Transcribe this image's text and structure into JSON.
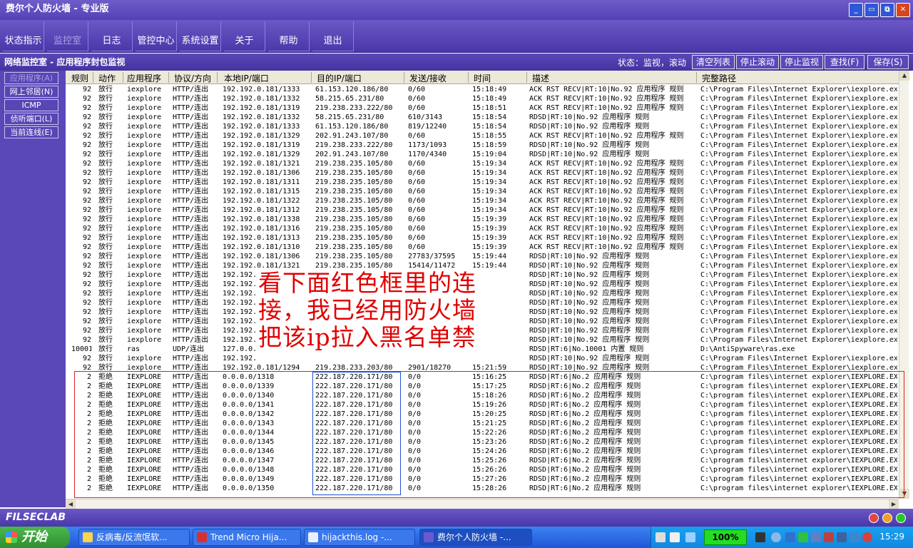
{
  "window": {
    "title": "费尔个人防火墙 - 专业版",
    "controls": [
      "_",
      "▭",
      "⧉",
      "✕"
    ]
  },
  "toolbar": [
    {
      "label": "状态指示",
      "enabled": true
    },
    {
      "label": "监控室",
      "enabled": false
    },
    {
      "label": "日志",
      "enabled": true
    },
    {
      "label": "管控中心",
      "enabled": true
    },
    {
      "label": "系统设置",
      "enabled": true
    },
    {
      "label": "关于",
      "enabled": true
    },
    {
      "label": "帮助",
      "enabled": true
    },
    {
      "label": "退出",
      "enabled": true
    }
  ],
  "subbar": {
    "title": "网络监控室 - 应用程序封包监视",
    "status": "状态：监视，滚动",
    "actions": [
      "清空列表",
      "停止滚动",
      "停止监视",
      "查找(F)",
      "保存(S)"
    ]
  },
  "sidebar": [
    {
      "label": "应用程序(A)",
      "enabled": false
    },
    {
      "label": "网上邻居(N)",
      "enabled": true
    },
    {
      "label": "ICMP",
      "enabled": true
    },
    {
      "label": "侦听端口(L)",
      "enabled": true
    },
    {
      "label": "当前连线(E)",
      "enabled": true
    }
  ],
  "columns": [
    "规则",
    "动作",
    "应用程序",
    "协议/方向",
    "本地IP/端口",
    "目的IP/端口",
    "发送/接收",
    "时间",
    "描述",
    "完整路径"
  ],
  "rows": [
    [
      "92",
      "放行",
      "iexplore",
      "HTTP/连出",
      "192.192.0.181/1333",
      "61.153.120.186/80",
      "0/60",
      "15:18:49",
      "ACK RST RECV|RT:10|No.92 应用程序 规则",
      "C:\\Program Files\\Internet Explorer\\iexplore.ex"
    ],
    [
      "92",
      "放行",
      "iexplore",
      "HTTP/连出",
      "192.192.0.181/1332",
      "58.215.65.231/80",
      "0/60",
      "15:18:49",
      "ACK RST RECV|RT:10|No.92 应用程序 规则",
      "C:\\Program Files\\Internet Explorer\\iexplore.ex"
    ],
    [
      "92",
      "放行",
      "iexplore",
      "HTTP/连出",
      "192.192.0.181/1319",
      "219.238.233.222/80",
      "0/60",
      "15:18:51",
      "ACK RST RECV|RT:10|No.92 应用程序 规则",
      "C:\\Program Files\\Internet Explorer\\iexplore.ex"
    ],
    [
      "92",
      "放行",
      "iexplore",
      "HTTP/连出",
      "192.192.0.181/1332",
      "58.215.65.231/80",
      "610/3143",
      "15:18:54",
      "RDSD|RT:10|No.92 应用程序 规则",
      "C:\\Program Files\\Internet Explorer\\iexplore.ex"
    ],
    [
      "92",
      "放行",
      "iexplore",
      "HTTP/连出",
      "192.192.0.181/1333",
      "61.153.120.186/80",
      "819/12240",
      "15:18:54",
      "RDSD|RT:10|No.92 应用程序 规则",
      "C:\\Program Files\\Internet Explorer\\iexplore.ex"
    ],
    [
      "92",
      "放行",
      "iexplore",
      "HTTP/连出",
      "192.192.0.181/1329",
      "202.91.243.107/80",
      "0/60",
      "15:18:55",
      "ACK RST RECV|RT:10|No.92 应用程序 规则",
      "C:\\Program Files\\Internet Explorer\\iexplore.ex"
    ],
    [
      "92",
      "放行",
      "iexplore",
      "HTTP/连出",
      "192.192.0.181/1319",
      "219.238.233.222/80",
      "1173/1093",
      "15:18:59",
      "RDSD|RT:10|No.92 应用程序 规则",
      "C:\\Program Files\\Internet Explorer\\iexplore.ex"
    ],
    [
      "92",
      "放行",
      "iexplore",
      "HTTP/连出",
      "192.192.0.181/1329",
      "202.91.243.107/80",
      "1170/4340",
      "15:19:04",
      "RDSD|RT:10|No.92 应用程序 规则",
      "C:\\Program Files\\Internet Explorer\\iexplore.ex"
    ],
    [
      "92",
      "放行",
      "iexplore",
      "HTTP/连出",
      "192.192.0.181/1321",
      "219.238.235.105/80",
      "0/60",
      "15:19:34",
      "ACK RST RECV|RT:10|No.92 应用程序 规则",
      "C:\\Program Files\\Internet Explorer\\iexplore.ex"
    ],
    [
      "92",
      "放行",
      "iexplore",
      "HTTP/连出",
      "192.192.0.181/1306",
      "219.238.235.105/80",
      "0/60",
      "15:19:34",
      "ACK RST RECV|RT:10|No.92 应用程序 规则",
      "C:\\Program Files\\Internet Explorer\\iexplore.ex"
    ],
    [
      "92",
      "放行",
      "iexplore",
      "HTTP/连出",
      "192.192.0.181/1311",
      "219.238.235.105/80",
      "0/60",
      "15:19:34",
      "ACK RST RECV|RT:10|No.92 应用程序 规则",
      "C:\\Program Files\\Internet Explorer\\iexplore.ex"
    ],
    [
      "92",
      "放行",
      "iexplore",
      "HTTP/连出",
      "192.192.0.181/1315",
      "219.238.235.105/80",
      "0/60",
      "15:19:34",
      "ACK RST RECV|RT:10|No.92 应用程序 规则",
      "C:\\Program Files\\Internet Explorer\\iexplore.ex"
    ],
    [
      "92",
      "放行",
      "iexplore",
      "HTTP/连出",
      "192.192.0.181/1322",
      "219.238.235.105/80",
      "0/60",
      "15:19:34",
      "ACK RST RECV|RT:10|No.92 应用程序 规则",
      "C:\\Program Files\\Internet Explorer\\iexplore.ex"
    ],
    [
      "92",
      "放行",
      "iexplore",
      "HTTP/连出",
      "192.192.0.181/1312",
      "219.238.235.105/80",
      "0/60",
      "15:19:34",
      "ACK RST RECV|RT:10|No.92 应用程序 规则",
      "C:\\Program Files\\Internet Explorer\\iexplore.ex"
    ],
    [
      "92",
      "放行",
      "iexplore",
      "HTTP/连出",
      "192.192.0.181/1338",
      "219.238.235.105/80",
      "0/60",
      "15:19:39",
      "ACK RST RECV|RT:10|No.92 应用程序 规则",
      "C:\\Program Files\\Internet Explorer\\iexplore.ex"
    ],
    [
      "92",
      "放行",
      "iexplore",
      "HTTP/连出",
      "192.192.0.181/1316",
      "219.238.235.105/80",
      "0/60",
      "15:19:39",
      "ACK RST RECV|RT:10|No.92 应用程序 规则",
      "C:\\Program Files\\Internet Explorer\\iexplore.ex"
    ],
    [
      "92",
      "放行",
      "iexplore",
      "HTTP/连出",
      "192.192.0.181/1313",
      "219.238.235.105/80",
      "0/60",
      "15:19:39",
      "ACK RST RECV|RT:10|No.92 应用程序 规则",
      "C:\\Program Files\\Internet Explorer\\iexplore.ex"
    ],
    [
      "92",
      "放行",
      "iexplore",
      "HTTP/连出",
      "192.192.0.181/1310",
      "219.238.235.105/80",
      "0/60",
      "15:19:39",
      "ACK RST RECV|RT:10|No.92 应用程序 规则",
      "C:\\Program Files\\Internet Explorer\\iexplore.ex"
    ],
    [
      "92",
      "放行",
      "iexplore",
      "HTTP/连出",
      "192.192.0.181/1306",
      "219.238.235.105/80",
      "27783/37595",
      "15:19:44",
      "RDSD|RT:10|No.92 应用程序 规则",
      "C:\\Program Files\\Internet Explorer\\iexplore.ex"
    ],
    [
      "92",
      "放行",
      "iexplore",
      "HTTP/连出",
      "192.192.0.181/1321",
      "219.238.235.105/80",
      "15414/11472",
      "15:19:44",
      "RDSD|RT:10|No.92 应用程序 规则",
      "C:\\Program Files\\Internet Explorer\\iexplore.ex"
    ],
    [
      "92",
      "放行",
      "iexplore",
      "HTTP/连出",
      "192.192.",
      "",
      "",
      "",
      "RDSD|RT:10|No.92 应用程序 规则",
      "C:\\Program Files\\Internet Explorer\\iexplore.ex"
    ],
    [
      "92",
      "放行",
      "iexplore",
      "HTTP/连出",
      "192.192.",
      "",
      "",
      "",
      "RDSD|RT:10|No.92 应用程序 规则",
      "C:\\Program Files\\Internet Explorer\\iexplore.ex"
    ],
    [
      "92",
      "放行",
      "iexplore",
      "HTTP/连出",
      "192.192.",
      "",
      "",
      "",
      "RDSD|RT:10|No.92 应用程序 规则",
      "C:\\Program Files\\Internet Explorer\\iexplore.ex"
    ],
    [
      "92",
      "放行",
      "iexplore",
      "HTTP/连出",
      "192.192.",
      "",
      "",
      "",
      "RDSD|RT:10|No.92 应用程序 规则",
      "C:\\Program Files\\Internet Explorer\\iexplore.ex"
    ],
    [
      "92",
      "放行",
      "iexplore",
      "HTTP/连出",
      "192.192.",
      "",
      "",
      "",
      "RDSD|RT:10|No.92 应用程序 规则",
      "C:\\Program Files\\Internet Explorer\\iexplore.ex"
    ],
    [
      "92",
      "放行",
      "iexplore",
      "HTTP/连出",
      "192.192.",
      "",
      "",
      "",
      "RDSD|RT:10|No.92 应用程序 规则",
      "C:\\Program Files\\Internet Explorer\\iexplore.ex"
    ],
    [
      "92",
      "放行",
      "iexplore",
      "HTTP/连出",
      "192.192.",
      "",
      "",
      "",
      "RDSD|RT:10|No.92 应用程序 规则",
      "C:\\Program Files\\Internet Explorer\\iexplore.ex"
    ],
    [
      "92",
      "放行",
      "iexplore",
      "HTTP/连出",
      "192.192.",
      "",
      "",
      "",
      "RDSD|RT:10|No.92 应用程序 规则",
      "C:\\Program Files\\Internet Explorer\\iexplore.ex"
    ],
    [
      "10001",
      "放行",
      "ras",
      "UDP/连出",
      "127.0.0.",
      "",
      "",
      "",
      "RDSD|RT:6|No.10001 内置 规则",
      "D:\\AntiSpyware\\ras.exe"
    ],
    [
      "92",
      "放行",
      "iexplore",
      "HTTP/连出",
      "192.192.",
      "",
      "",
      "",
      "RDSD|RT:10|No.92 应用程序 规则",
      "C:\\Program Files\\Internet Explorer\\iexplore.ex"
    ],
    [
      "92",
      "放行",
      "iexplore",
      "HTTP/连出",
      "192.192.0.181/1294",
      "219.238.233.203/80",
      "2901/18270",
      "15:21:59",
      "RDSD|RT:10|No.92 应用程序 规则",
      "C:\\Program Files\\Internet Explorer\\iexplore.ex"
    ],
    [
      "2",
      "拒绝",
      "IEXPLORE",
      "HTTP/连出",
      "0.0.0.0/1318",
      "222.187.220.171/80",
      "0/0",
      "15:16:25",
      "RDSD|RT:6|No.2 应用程序 规则",
      "C:\\program files\\internet explorer\\IEXPLORE.EX"
    ],
    [
      "2",
      "拒绝",
      "IEXPLORE",
      "HTTP/连出",
      "0.0.0.0/1339",
      "222.187.220.171/80",
      "0/0",
      "15:17:25",
      "RDSD|RT:6|No.2 应用程序 规则",
      "C:\\program files\\internet explorer\\IEXPLORE.EX"
    ],
    [
      "2",
      "拒绝",
      "IEXPLORE",
      "HTTP/连出",
      "0.0.0.0/1340",
      "222.187.220.171/80",
      "0/0",
      "15:18:26",
      "RDSD|RT:6|No.2 应用程序 规则",
      "C:\\program files\\internet explorer\\IEXPLORE.EX"
    ],
    [
      "2",
      "拒绝",
      "IEXPLORE",
      "HTTP/连出",
      "0.0.0.0/1341",
      "222.187.220.171/80",
      "0/0",
      "15:19:26",
      "RDSD|RT:6|No.2 应用程序 规则",
      "C:\\program files\\internet explorer\\IEXPLORE.EX"
    ],
    [
      "2",
      "拒绝",
      "IEXPLORE",
      "HTTP/连出",
      "0.0.0.0/1342",
      "222.187.220.171/80",
      "0/0",
      "15:20:25",
      "RDSD|RT:6|No.2 应用程序 规则",
      "C:\\program files\\internet explorer\\IEXPLORE.EX"
    ],
    [
      "2",
      "拒绝",
      "IEXPLORE",
      "HTTP/连出",
      "0.0.0.0/1343",
      "222.187.220.171/80",
      "0/0",
      "15:21:25",
      "RDSD|RT:6|No.2 应用程序 规则",
      "C:\\program files\\internet explorer\\IEXPLORE.EX"
    ],
    [
      "2",
      "拒绝",
      "IEXPLORE",
      "HTTP/连出",
      "0.0.0.0/1344",
      "222.187.220.171/80",
      "0/0",
      "15:22:26",
      "RDSD|RT:6|No.2 应用程序 规则",
      "C:\\program files\\internet explorer\\IEXPLORE.EX"
    ],
    [
      "2",
      "拒绝",
      "IEXPLORE",
      "HTTP/连出",
      "0.0.0.0/1345",
      "222.187.220.171/80",
      "0/0",
      "15:23:26",
      "RDSD|RT:6|No.2 应用程序 规则",
      "C:\\program files\\internet explorer\\IEXPLORE.EX"
    ],
    [
      "2",
      "拒绝",
      "IEXPLORE",
      "HTTP/连出",
      "0.0.0.0/1346",
      "222.187.220.171/80",
      "0/0",
      "15:24:26",
      "RDSD|RT:6|No.2 应用程序 规则",
      "C:\\program files\\internet explorer\\IEXPLORE.EX"
    ],
    [
      "2",
      "拒绝",
      "IEXPLORE",
      "HTTP/连出",
      "0.0.0.0/1347",
      "222.187.220.171/80",
      "0/0",
      "15:25:26",
      "RDSD|RT:6|No.2 应用程序 规则",
      "C:\\program files\\internet explorer\\IEXPLORE.EX"
    ],
    [
      "2",
      "拒绝",
      "IEXPLORE",
      "HTTP/连出",
      "0.0.0.0/1348",
      "222.187.220.171/80",
      "0/0",
      "15:26:26",
      "RDSD|RT:6|No.2 应用程序 规则",
      "C:\\program files\\internet explorer\\IEXPLORE.EX"
    ],
    [
      "2",
      "拒绝",
      "IEXPLORE",
      "HTTP/连出",
      "0.0.0.0/1349",
      "222.187.220.171/80",
      "0/0",
      "15:27:26",
      "RDSD|RT:6|No.2 应用程序 规则",
      "C:\\program files\\internet explorer\\IEXPLORE.EX"
    ],
    [
      "2",
      "拒绝",
      "IEXPLORE",
      "HTTP/连出",
      "0.0.0.0/1350",
      "222.187.220.171/80",
      "0/0",
      "15:28:26",
      "RDSD|RT:6|No.2 应用程序 规则",
      "C:\\program files\\internet explorer\\IEXPLORE.EX"
    ]
  ],
  "annotation": {
    "lines": [
      "看下面红色框里的连",
      "接，我已经用防火墙",
      "把该ip拉入黑名单禁"
    ],
    "color": "#e00000"
  },
  "brand": "FILSECLAB",
  "taskbar": {
    "start": "开始",
    "tasks": [
      {
        "label": "反病毒/反流氓软...",
        "icon": "browser-icon"
      },
      {
        "label": "Trend Micro Hija...",
        "icon": "trend-micro-icon"
      },
      {
        "label": "hijackthis.log -...",
        "icon": "notepad-icon"
      },
      {
        "label": "费尔个人防火墙 -...",
        "icon": "firewall-icon"
      }
    ],
    "zoom": "100%",
    "clock": "15:29"
  }
}
